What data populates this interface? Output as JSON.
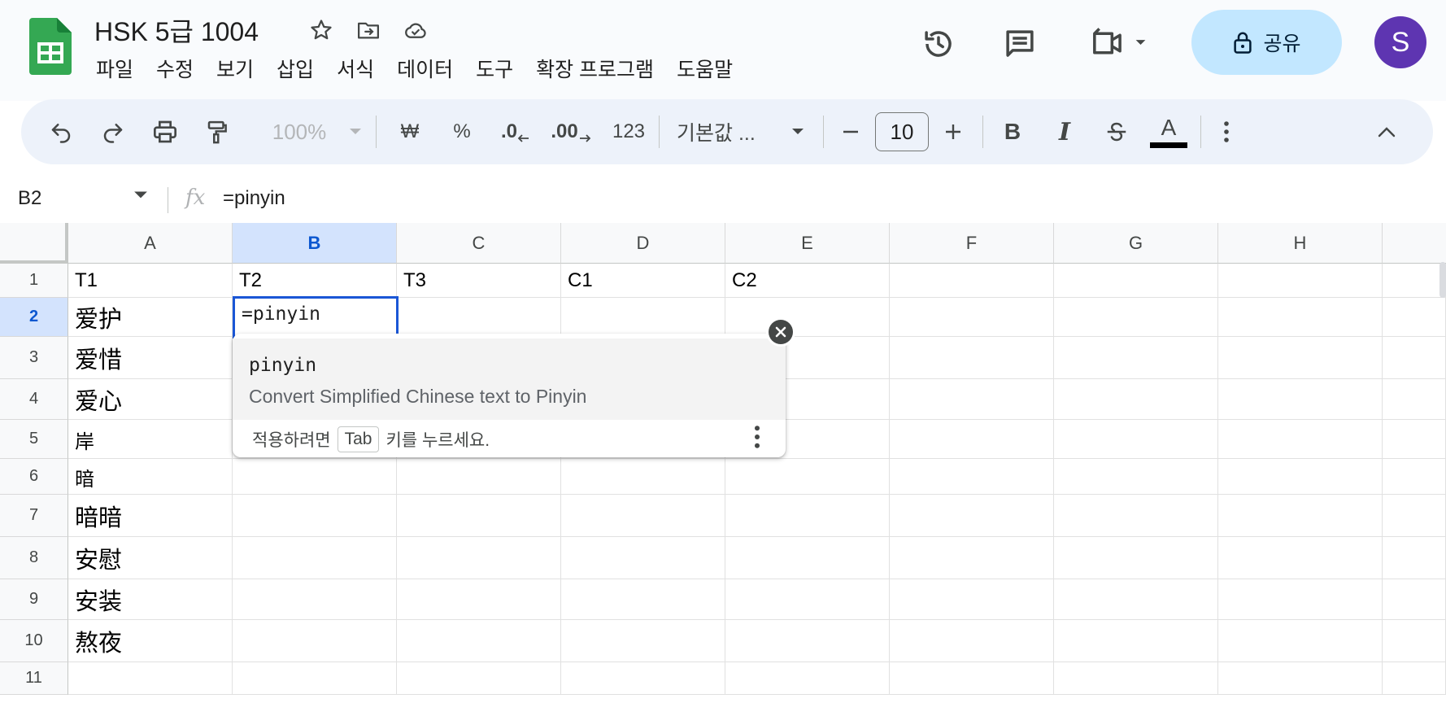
{
  "header": {
    "title": "HSK 5급 1004",
    "menus": [
      "파일",
      "수정",
      "보기",
      "삽입",
      "서식",
      "데이터",
      "도구",
      "확장 프로그램",
      "도움말"
    ],
    "share_label": "공유",
    "avatar_letter": "S"
  },
  "toolbar": {
    "zoom": "100%",
    "currency_symbol": "₩",
    "percent_symbol": "%",
    "decrease_decimal": ".0",
    "increase_decimal": ".00",
    "number_format": "123",
    "font_name": "기본값 ...",
    "font_size": "10",
    "bold": "B",
    "italic": "I",
    "text_color_letter": "A",
    "text_color": "#000000"
  },
  "formula_bar": {
    "cell_ref": "B2",
    "fx": "fx",
    "formula": "=pinyin"
  },
  "grid": {
    "columns": [
      "A",
      "B",
      "C",
      "D",
      "E",
      "F",
      "G",
      "H"
    ],
    "selected_column": "B",
    "rows": [
      "1",
      "2",
      "3",
      "4",
      "5",
      "6",
      "7",
      "8",
      "9",
      "10",
      "11"
    ],
    "selected_row": "2",
    "header_row": [
      "T1",
      "T2",
      "T3",
      "C1",
      "C2"
    ],
    "column_a": [
      "爱护",
      "爱惜",
      "爱心",
      "岸",
      "暗",
      "暗暗",
      "安慰",
      "安装",
      "熬夜"
    ],
    "active_cell_value": "=pinyin"
  },
  "autocomplete": {
    "function_name": "pinyin",
    "description": "Convert Simplified Chinese text to Pinyin",
    "hint_before": "적용하려면",
    "hint_key": "Tab",
    "hint_after": "키를 누르세요."
  },
  "colors": {
    "accent": "#0b57d0",
    "share_bg": "#c2e7ff",
    "avatar_bg": "#5e35b1",
    "sheets_green": "#34a853"
  }
}
